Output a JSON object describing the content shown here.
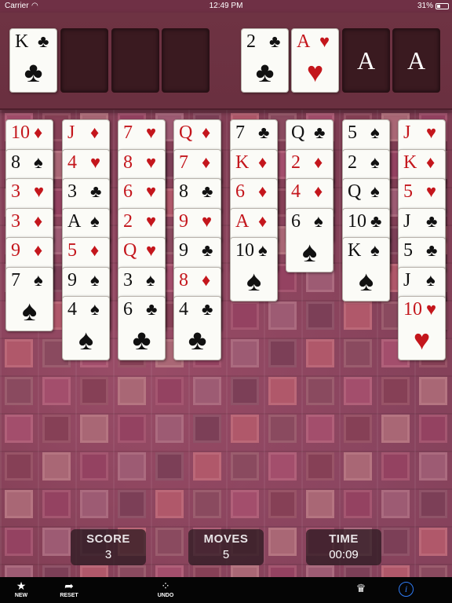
{
  "status_bar": {
    "carrier": "Carrier",
    "time": "12:49 PM",
    "battery": "31%"
  },
  "colors": {
    "red_suit": "#c4161c",
    "black_suit": "#111111",
    "info_blue": "#2f7cf6"
  },
  "free_cells": [
    {
      "rank": "K",
      "suit": "♣",
      "color": "black"
    },
    null,
    null,
    null
  ],
  "foundations": [
    {
      "type": "card",
      "rank": "2",
      "suit": "♣",
      "color": "black"
    },
    {
      "type": "card",
      "rank": "A",
      "suit": "♥",
      "color": "red"
    },
    {
      "type": "empty",
      "label": "A"
    },
    {
      "type": "empty",
      "label": "A"
    }
  ],
  "tableau": [
    [
      [
        "10",
        "♦",
        "red"
      ],
      [
        "8",
        "♠",
        "black"
      ],
      [
        "3",
        "♥",
        "red"
      ],
      [
        "3",
        "♦",
        "red"
      ],
      [
        "9",
        "♦",
        "red"
      ],
      [
        "7",
        "♠",
        "black"
      ]
    ],
    [
      [
        "J",
        "♦",
        "red"
      ],
      [
        "4",
        "♥",
        "red"
      ],
      [
        "3",
        "♣",
        "black"
      ],
      [
        "A",
        "♠",
        "black"
      ],
      [
        "5",
        "♦",
        "red"
      ],
      [
        "9",
        "♠",
        "black"
      ],
      [
        "4",
        "♠",
        "black"
      ]
    ],
    [
      [
        "7",
        "♥",
        "red"
      ],
      [
        "8",
        "♥",
        "red"
      ],
      [
        "6",
        "♥",
        "red"
      ],
      [
        "2",
        "♥",
        "red"
      ],
      [
        "Q",
        "♥",
        "red"
      ],
      [
        "3",
        "♠",
        "black"
      ],
      [
        "6",
        "♣",
        "black"
      ]
    ],
    [
      [
        "Q",
        "♦",
        "red"
      ],
      [
        "7",
        "♦",
        "red"
      ],
      [
        "8",
        "♣",
        "black"
      ],
      [
        "9",
        "♥",
        "red"
      ],
      [
        "9",
        "♣",
        "black"
      ],
      [
        "8",
        "♦",
        "red"
      ],
      [
        "4",
        "♣",
        "black"
      ]
    ],
    [
      [
        "7",
        "♣",
        "black"
      ],
      [
        "K",
        "♦",
        "red"
      ],
      [
        "6",
        "♦",
        "red"
      ],
      [
        "A",
        "♦",
        "red"
      ],
      [
        "10",
        "♠",
        "black"
      ]
    ],
    [
      [
        "Q",
        "♣",
        "black"
      ],
      [
        "2",
        "♦",
        "red"
      ],
      [
        "4",
        "♦",
        "red"
      ],
      [
        "6",
        "♠",
        "black"
      ]
    ],
    [
      [
        "5",
        "♠",
        "black"
      ],
      [
        "2",
        "♠",
        "black"
      ],
      [
        "Q",
        "♠",
        "black"
      ],
      [
        "10",
        "♣",
        "black"
      ],
      [
        "K",
        "♠",
        "black"
      ]
    ],
    [
      [
        "J",
        "♥",
        "red"
      ],
      [
        "K",
        "♦",
        "red"
      ],
      [
        "5",
        "♥",
        "red"
      ],
      [
        "J",
        "♣",
        "black"
      ],
      [
        "5",
        "♣",
        "black"
      ],
      [
        "J",
        "♠",
        "black"
      ],
      [
        "10",
        "♥",
        "red"
      ]
    ]
  ],
  "stats": {
    "score_label": "SCORE",
    "score": "3",
    "moves_label": "MOVES",
    "moves": "5",
    "time_label": "TIME",
    "time": "00:09"
  },
  "toolbar": {
    "new_label": "NEW",
    "reset_label": "RESET",
    "undo_label": "UNDO",
    "new_icon": "star-icon",
    "reset_icon": "reset-arrow-icon",
    "undo_icon": "undo-dots-icon",
    "crown_icon": "crown-icon",
    "info_icon": "info-icon"
  }
}
